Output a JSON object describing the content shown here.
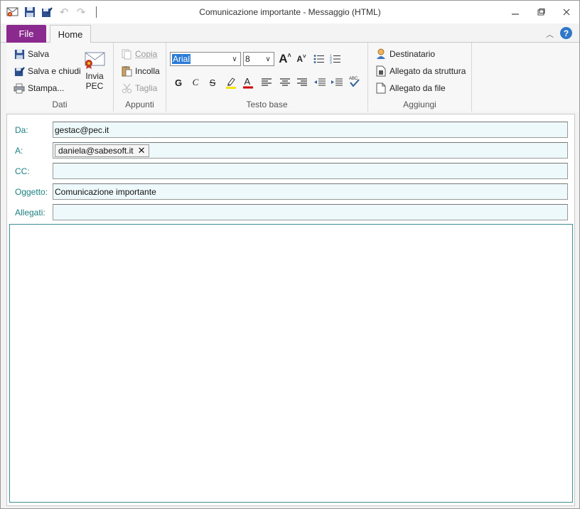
{
  "window": {
    "title": "Comunicazione importante - Messaggio (HTML)"
  },
  "tabs": {
    "file": "File",
    "home": "Home"
  },
  "ribbon": {
    "dati": {
      "label": "Dati",
      "salva": "Salva",
      "salva_chiudi": "Salva e chiudi",
      "stampa": "Stampa...",
      "invia_line1": "Invia",
      "invia_line2": "PEC"
    },
    "appunti": {
      "label": "Appunti",
      "copia": "Copia",
      "incolla": "Incolla",
      "taglia": "Taglia"
    },
    "testo": {
      "label": "Testo base",
      "font": "Arial",
      "size": "8",
      "bold": "G",
      "italic": "C",
      "strike": "S"
    },
    "aggiungi": {
      "label": "Aggiungi",
      "destinatario": "Destinatario",
      "allegato_struttura": "Allegato da struttura",
      "allegato_file": "Allegato da file"
    }
  },
  "form": {
    "da_label": "Da:",
    "da_value": "gestac@pec.it",
    "a_label": "A:",
    "a_recipients": [
      "daniela@sabesoft.it"
    ],
    "cc_label": "CC:",
    "cc_value": "",
    "oggetto_label": "Oggetto:",
    "oggetto_value": "Comunicazione importante",
    "allegati_label": "Allegati:",
    "allegati_value": "",
    "body": ""
  },
  "colors": {
    "file_tab": "#8b2a8e",
    "label_teal": "#1b7f7f",
    "field_bg": "#eef9fb",
    "help_blue": "#2f77c9"
  }
}
